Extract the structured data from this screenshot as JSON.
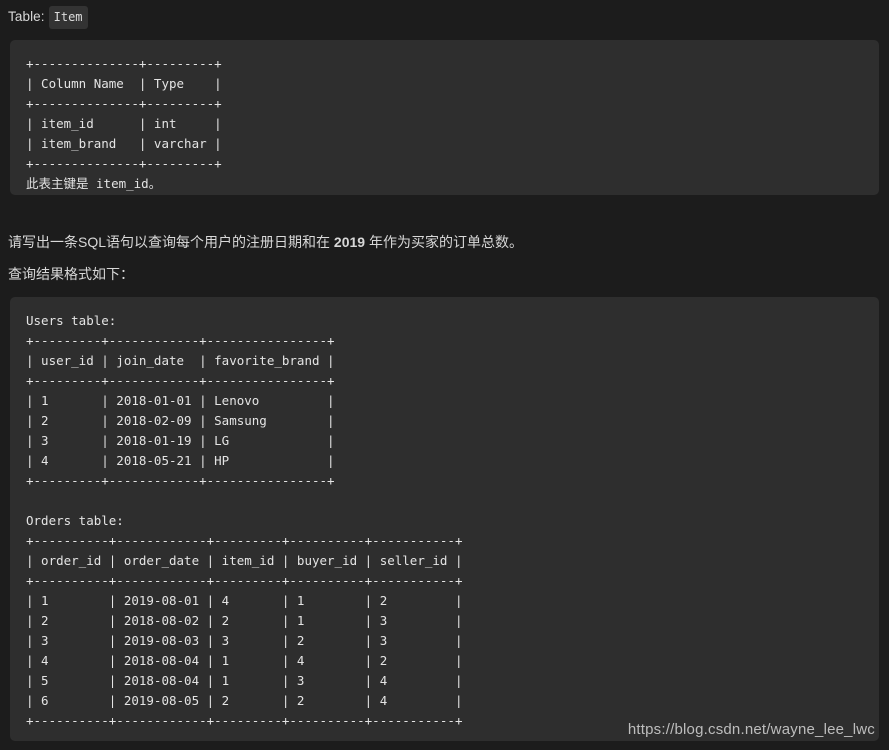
{
  "header": {
    "label": "Table:",
    "code_badge": "Item"
  },
  "item_table_block": {
    "content": "+--------------+---------+\n| Column Name  | Type    |\n+--------------+---------+\n| item_id      | int     |\n| item_brand   | varchar |\n+--------------+---------+\n此表主键是 item_id。"
  },
  "question": {
    "prefix": "请写出一条SQL语句以查询每个用户的注册日期和在 ",
    "bold_year": "2019",
    "suffix": " 年作为买家的订单总数。"
  },
  "format_note": {
    "text": "查询结果格式如下："
  },
  "result_block": {
    "content": "Users table:\n+---------+------------+----------------+\n| user_id | join_date  | favorite_brand |\n+---------+------------+----------------+\n| 1       | 2018-01-01 | Lenovo         |\n| 2       | 2018-02-09 | Samsung        |\n| 3       | 2018-01-19 | LG             |\n| 4       | 2018-05-21 | HP             |\n+---------+------------+----------------+\n\nOrders table:\n+----------+------------+---------+----------+-----------+\n| order_id | order_date | item_id | buyer_id | seller_id |\n+----------+------------+---------+----------+-----------+\n| 1        | 2019-08-01 | 4       | 1        | 2         |\n| 2        | 2018-08-02 | 2       | 1        | 3         |\n| 3        | 2019-08-03 | 3       | 2        | 3         |\n| 4        | 2018-08-04 | 1       | 4        | 2         |\n| 5        | 2018-08-04 | 1       | 3        | 4         |\n| 6        | 2019-08-05 | 2       | 2        | 4         |\n+----------+------------+---------+----------+-----------+"
  },
  "watermark": {
    "url": "https://blog.csdn.net/wayne_lee_lwc"
  },
  "colors": {
    "page_background": "#1c1c1c",
    "code_background": "#2e2e2e",
    "inline_code_background": "#333333",
    "text": "#d8d8d8",
    "code_text": "#e4e4e4",
    "watermark_text": "#bdbdbd"
  },
  "tables": {
    "item": {
      "name": "Item",
      "columns": [
        "Column Name",
        "Type"
      ],
      "rows": [
        [
          "item_id",
          "int"
        ],
        [
          "item_brand",
          "varchar"
        ]
      ],
      "primary_key_note": "此表主键是 item_id。"
    },
    "users": {
      "caption": "Users table:",
      "columns": [
        "user_id",
        "join_date",
        "favorite_brand"
      ],
      "rows": [
        [
          "1",
          "2018-01-01",
          "Lenovo"
        ],
        [
          "2",
          "2018-02-09",
          "Samsung"
        ],
        [
          "3",
          "2018-01-19",
          "LG"
        ],
        [
          "4",
          "2018-05-21",
          "HP"
        ]
      ]
    },
    "orders": {
      "caption": "Orders table:",
      "columns": [
        "order_id",
        "order_date",
        "item_id",
        "buyer_id",
        "seller_id"
      ],
      "rows": [
        [
          "1",
          "2019-08-01",
          "4",
          "1",
          "2"
        ],
        [
          "2",
          "2018-08-02",
          "2",
          "1",
          "3"
        ],
        [
          "3",
          "2019-08-03",
          "3",
          "2",
          "3"
        ],
        [
          "4",
          "2018-08-04",
          "1",
          "4",
          "2"
        ],
        [
          "5",
          "2018-08-04",
          "1",
          "3",
          "4"
        ],
        [
          "6",
          "2019-08-05",
          "2",
          "2",
          "4"
        ]
      ]
    }
  }
}
